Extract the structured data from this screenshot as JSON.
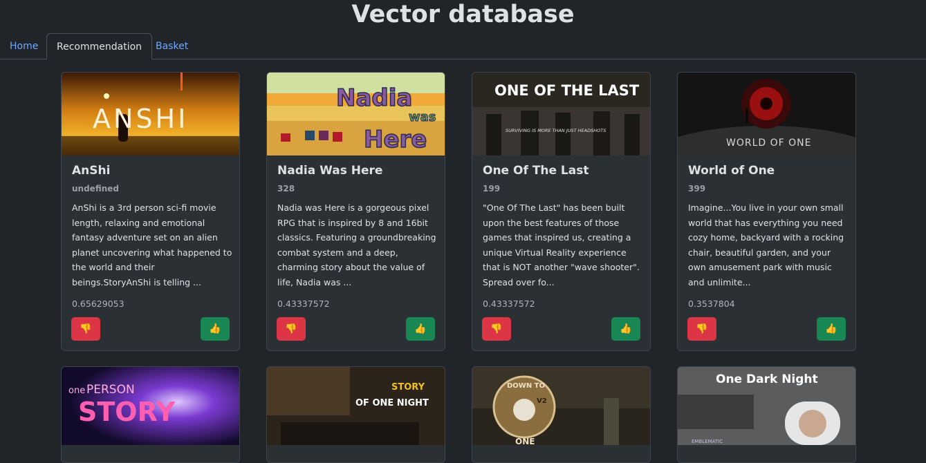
{
  "page": {
    "title": "Vector database"
  },
  "nav": {
    "tabs": [
      {
        "label": "Home",
        "active": false
      },
      {
        "label": "Recommendation",
        "active": true
      },
      {
        "label": "Basket",
        "active": false
      }
    ]
  },
  "cards": [
    {
      "title": "AnShi",
      "subtitle": "undefined",
      "description": "AnShi is a 3rd person sci-fi movie length, relaxing and emotional fantasy adventure set on an alien planet uncovering what happened to the world and their beings.StoryAnShi is telling ...",
      "score": "0.65629053",
      "image_text": "ANSHI"
    },
    {
      "title": "Nadia Was Here",
      "subtitle": "328",
      "description": "Nadia was Here is a gorgeous pixel RPG that is inspired by 8 and 16bit classics. Featuring a groundbreaking combat system and a deep, charming story about the value of life, Nadia was ...",
      "score": "0.43337572",
      "image_text": [
        "Nadia",
        "was",
        "Here"
      ]
    },
    {
      "title": "One Of The Last",
      "subtitle": "199",
      "description": "\"One Of The Last\" has been built upon the best features of those games that inspired us, creating a unique Virtual Reality experience that is NOT another \"wave shooter\". Spread over fo...",
      "score": "0.43337572",
      "image_text": [
        "ONE OF THE LAST",
        "SURVIVING IS MORE THAN JUST HEADSHOTS"
      ]
    },
    {
      "title": "World of One",
      "subtitle": "399",
      "description": "Imagine...You live in your own small world that has everything you need cozy home, backyard with a rocking chair, beautiful garden, and your own amusement park with music and unlimite...",
      "score": "0.3537804",
      "image_text": "WORLD OF ONE"
    }
  ],
  "cards_row2": [
    {
      "image_text": [
        "one",
        "PERSON",
        "STORY"
      ]
    },
    {
      "image_text": [
        "STORY",
        "OF ONE NIGHT"
      ]
    },
    {
      "image_text": [
        "DOWN TO",
        "V2",
        "ONE"
      ]
    },
    {
      "image_text": [
        "One Dark Night",
        "EMBLEMATIC"
      ]
    }
  ],
  "buttons": {
    "dislike_icon": "👎",
    "like_icon": "👍"
  },
  "colors": {
    "background": "#212529",
    "card": "#2b3035",
    "link": "#6ea8fe",
    "danger": "#dc3545",
    "success": "#198754"
  }
}
